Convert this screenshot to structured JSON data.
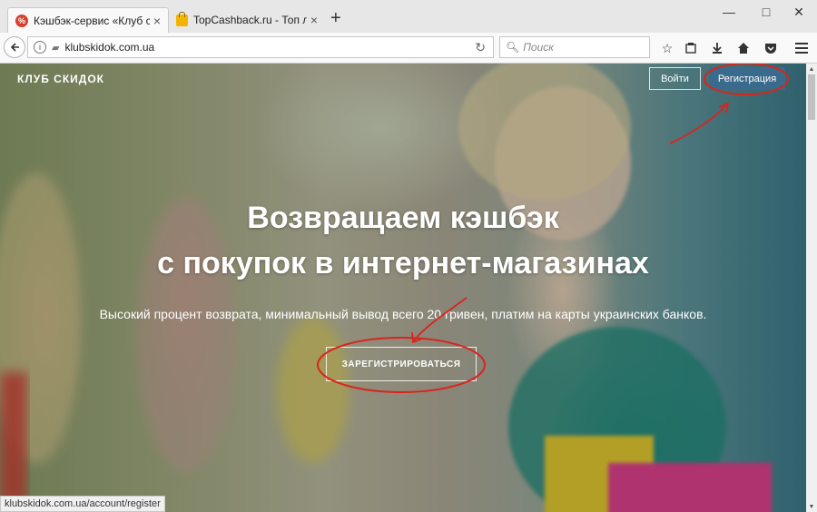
{
  "browser": {
    "tabs": [
      {
        "label": "Кэшбэк-сервис «Клуб скидок»",
        "icon": "club-favicon",
        "favicon_text": "%",
        "active": true
      },
      {
        "label": "TopCashback.ru - Топ лучших",
        "icon": "topcashback-favicon",
        "active": false
      }
    ],
    "new_tab_symbol": "+",
    "close_symbol": "×",
    "window_controls": {
      "minimize": "—",
      "maximize": "□",
      "close": "✕"
    },
    "url": "klubskidok.com.ua",
    "search_placeholder": "Поиск",
    "status_url": "klubskidok.com.ua/account/register"
  },
  "site": {
    "brand": "КЛУБ СКИДОК",
    "login_label": "Войти",
    "register_label": "Регистрация",
    "hero_title_line1": "Возвращаем кэшбэк",
    "hero_title_line2": "с покупок в интернет-магазинах",
    "hero_subtitle": "Высокий процент возврата, минимальный вывод всего 20 гривен, платим на карты украинских банков.",
    "cta_label": "ЗАРЕГИСТРИРОВАТЬСЯ"
  },
  "colors": {
    "register_bg": "#3b6b8c",
    "annotation_red": "#d9241f"
  }
}
